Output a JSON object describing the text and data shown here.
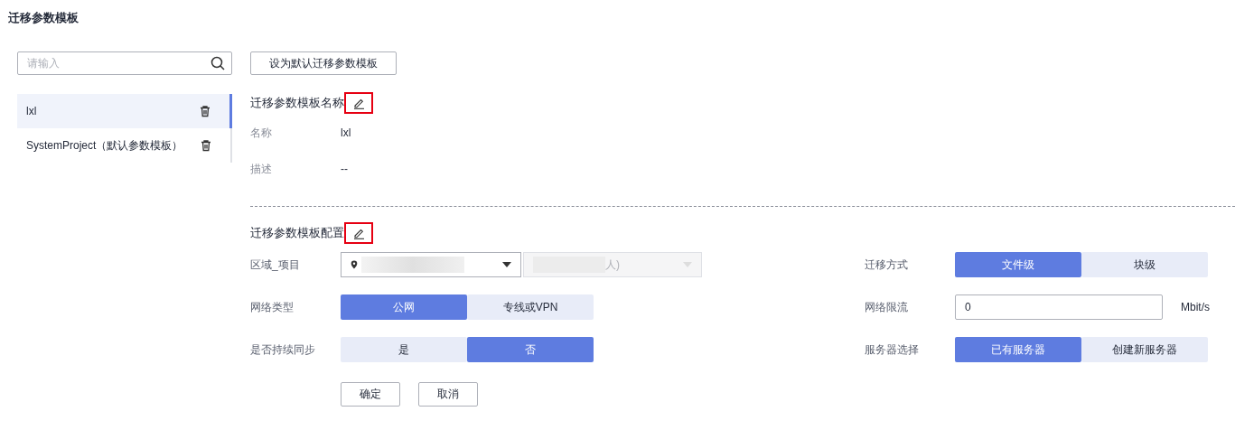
{
  "page_title": "迁移参数模板",
  "search": {
    "placeholder": "请输入"
  },
  "templates": [
    {
      "name": "lxl",
      "selected": true
    },
    {
      "name": "SystemProject（默认参数模板）",
      "selected": false
    }
  ],
  "set_default_button": "设为默认迁移参数模板",
  "name_section": {
    "heading": "迁移参数模板名称",
    "edit_highlighted": true,
    "fields": [
      {
        "label": "名称",
        "value": "lxl"
      },
      {
        "label": "描述",
        "value": "--"
      }
    ]
  },
  "config_section": {
    "heading": "迁移参数模板配置",
    "edit_highlighted": true,
    "left_rows": [
      {
        "kind": "selects",
        "label": "区域_项目",
        "selects": [
          {
            "redacted": true,
            "disabled": false,
            "location_icon": true
          },
          {
            "value": "人)",
            "redacted": true,
            "disabled": true,
            "location_icon": false
          }
        ]
      },
      {
        "kind": "segmented",
        "label": "网络类型",
        "options": [
          {
            "label": "公网",
            "selected": true
          },
          {
            "label": "专线或VPN",
            "selected": false
          }
        ]
      },
      {
        "kind": "segmented",
        "label": "是否持续同步",
        "options": [
          {
            "label": "是",
            "selected": false
          },
          {
            "label": "否",
            "selected": true
          }
        ]
      }
    ],
    "right_rows": [
      {
        "kind": "segmented",
        "label": "迁移方式",
        "options": [
          {
            "label": "文件级",
            "selected": true
          },
          {
            "label": "块级",
            "selected": false
          }
        ]
      },
      {
        "kind": "input",
        "label": "网络限流",
        "value": "0",
        "unit": "Mbit/s"
      },
      {
        "kind": "segmented",
        "label": "服务器选择",
        "options": [
          {
            "label": "已有服务器",
            "selected": true
          },
          {
            "label": "创建新服务器",
            "selected": false
          }
        ]
      }
    ]
  },
  "actions": [
    "确定",
    "取消"
  ]
}
